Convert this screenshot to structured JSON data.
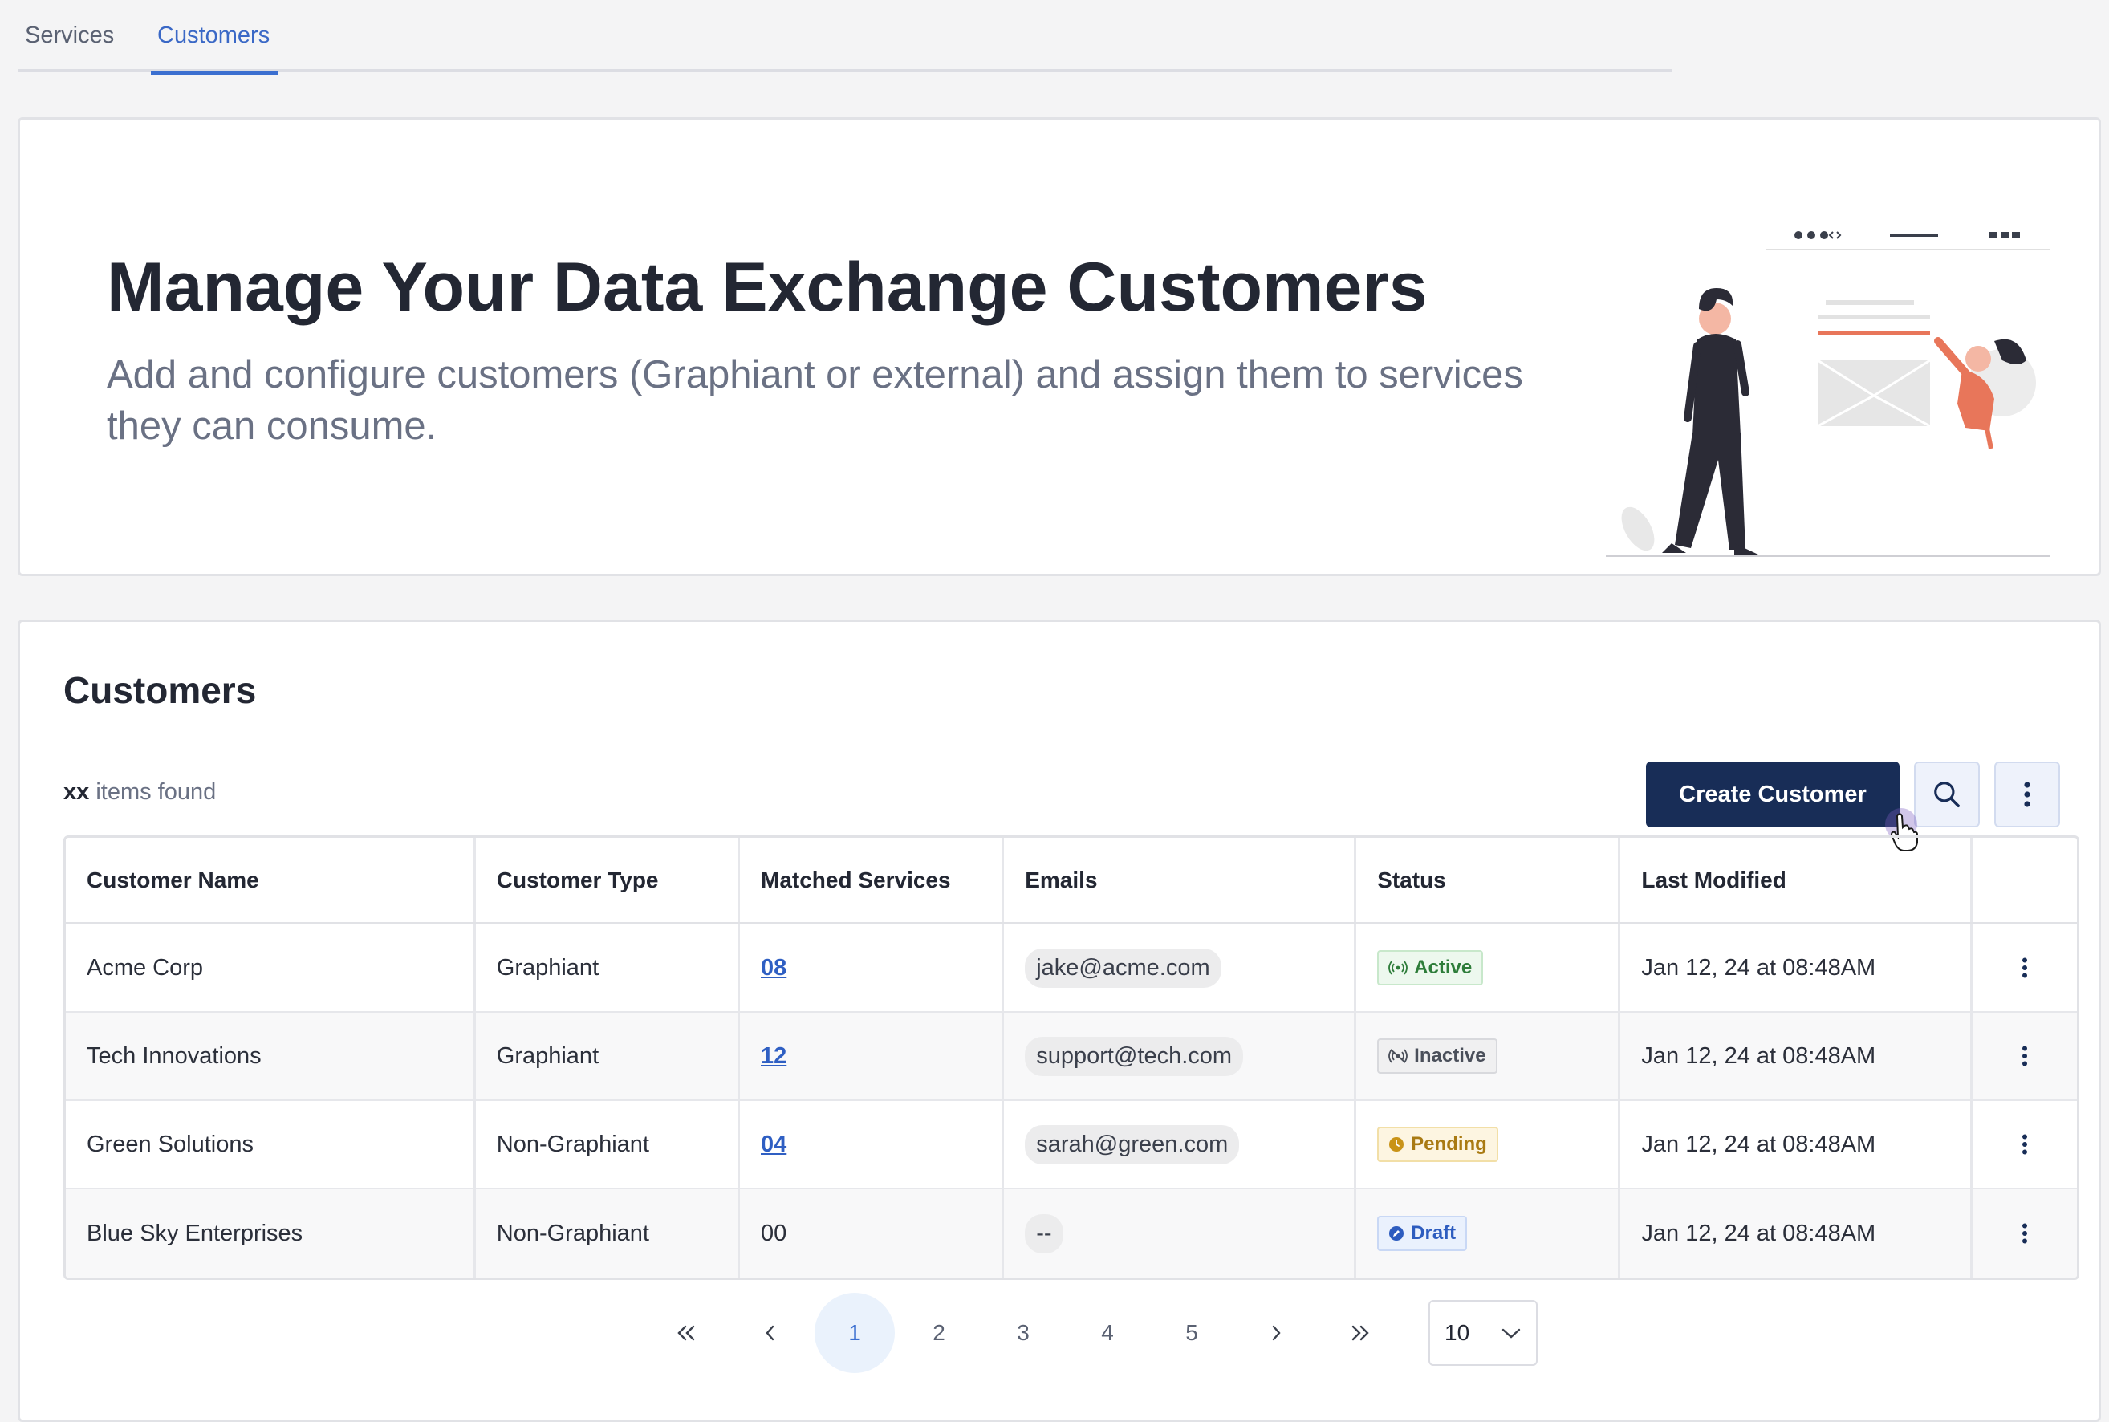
{
  "tabs": [
    {
      "label": "Services",
      "active": false
    },
    {
      "label": "Customers",
      "active": true
    }
  ],
  "hero": {
    "title": "Manage Your Data Exchange Customers",
    "subtitle": "Add and configure customers (Graphiant or external) and assign them to services they can consume."
  },
  "customers": {
    "title": "Customers",
    "count_value": "xx",
    "count_suffix": "items found",
    "create_label": "Create Customer",
    "columns": [
      "Customer Name",
      "Customer Type",
      "Matched Services",
      "Emails",
      "Status",
      "Last Modified"
    ],
    "rows": [
      {
        "name": "Acme Corp",
        "type": "Graphiant",
        "matched": "08",
        "email": "jake@acme.com",
        "status": "Active",
        "status_kind": "active",
        "modified": "Jan 12, 24 at 08:48AM"
      },
      {
        "name": "Tech Innovations",
        "type": "Graphiant",
        "matched": "12",
        "email": "support@tech.com",
        "status": "Inactive",
        "status_kind": "inactive",
        "modified": "Jan 12, 24 at 08:48AM"
      },
      {
        "name": "Green Solutions",
        "type": "Non-Graphiant",
        "matched": "04",
        "email": "sarah@green.com",
        "status": "Pending",
        "status_kind": "pending",
        "modified": "Jan 12, 24 at 08:48AM"
      },
      {
        "name": "Blue Sky Enterprises",
        "type": "Non-Graphiant",
        "matched": "00",
        "email": "--",
        "status": "Draft",
        "status_kind": "draft",
        "modified": "Jan 12, 24 at 08:48AM"
      }
    ]
  },
  "pagination": {
    "first": "«",
    "prev": "‹",
    "pages": [
      "1",
      "2",
      "3",
      "4",
      "5"
    ],
    "current": "1",
    "next": "›",
    "last": "»",
    "page_size": "10"
  },
  "colors": {
    "primary": "#182d57",
    "accent": "#3b6fd0",
    "active": "#2e7d3a",
    "pending": "#a97a12",
    "draft": "#2d5cbf"
  }
}
